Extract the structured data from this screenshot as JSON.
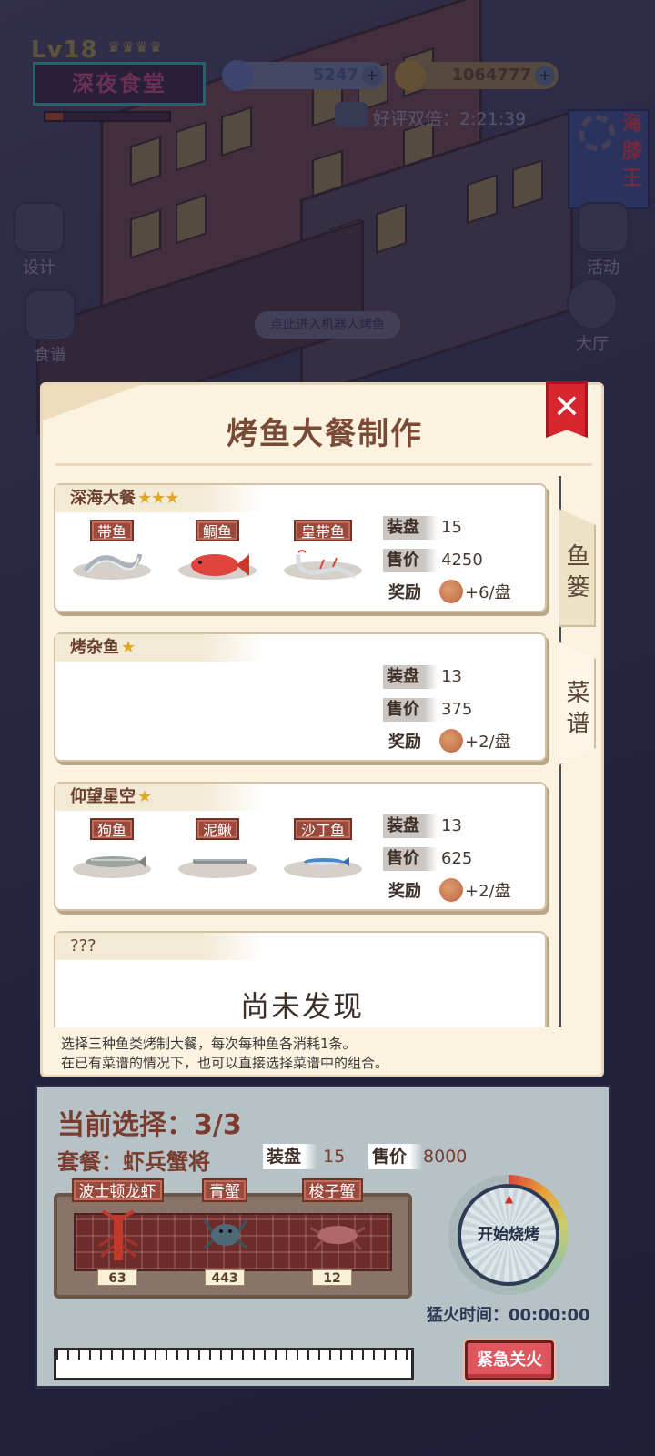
{
  "hud": {
    "level": "Lv18",
    "shop_name": "深夜食堂",
    "gems": "5247",
    "coins": "1064777",
    "bonus_timer": "好评双倍：2:21:39",
    "left_menu": [
      "设计",
      "食谱"
    ],
    "right_menu": [
      "活动",
      "大厅"
    ],
    "robot_tip": "点此进入机器人烤鱼",
    "corner_sign": [
      "海",
      "膝",
      "王"
    ]
  },
  "dialog": {
    "title": "烤鱼大餐制作",
    "tabs": [
      "鱼篓",
      "菜谱"
    ],
    "recipes": [
      {
        "name": "深海大餐",
        "stars": 3,
        "fish": [
          "带鱼",
          "鲷鱼",
          "皇带鱼"
        ],
        "plates_label": "装盘",
        "plates": "15",
        "price_label": "售价",
        "price": "4250",
        "reward_label": "奖励",
        "reward": "+6/盘"
      },
      {
        "name": "烤杂鱼",
        "stars": 1,
        "fish": [],
        "plates_label": "装盘",
        "plates": "13",
        "price_label": "售价",
        "price": "375",
        "reward_label": "奖励",
        "reward": "+2/盘"
      },
      {
        "name": "仰望星空",
        "stars": 1,
        "fish": [
          "狗鱼",
          "泥鳅",
          "沙丁鱼"
        ],
        "plates_label": "装盘",
        "plates": "13",
        "price_label": "售价",
        "price": "625",
        "reward_label": "奖励",
        "reward": "+2/盘"
      },
      {
        "name": "???",
        "undiscovered": "尚未发现"
      }
    ],
    "hint_lines": [
      "选择三种鱼类烤制大餐，每次每种鱼各消耗1条。",
      "在已有菜谱的情况下，也可以直接选择菜谱中的组合。"
    ]
  },
  "grill": {
    "selection": "当前选择：3/3",
    "combo": "套餐：虾兵蟹将",
    "plates_label": "装盘",
    "plates": "15",
    "price_label": "售价",
    "price": "8000",
    "slots": [
      {
        "name": "波士顿龙虾",
        "count": "63"
      },
      {
        "name": "青蟹",
        "count": "443"
      },
      {
        "name": "梭子蟹",
        "count": "12"
      }
    ],
    "start_label": "开始烧烤",
    "fire_time": "猛火时间：00:00:00",
    "emergency_label": "紧急关火"
  },
  "colors": {
    "title_brown": "#7a4a36",
    "tag_red": "#9a4a3c",
    "close_red": "#d8262e",
    "panel_blue": "#b6c2c6",
    "star_gold": "#e3a81f"
  }
}
